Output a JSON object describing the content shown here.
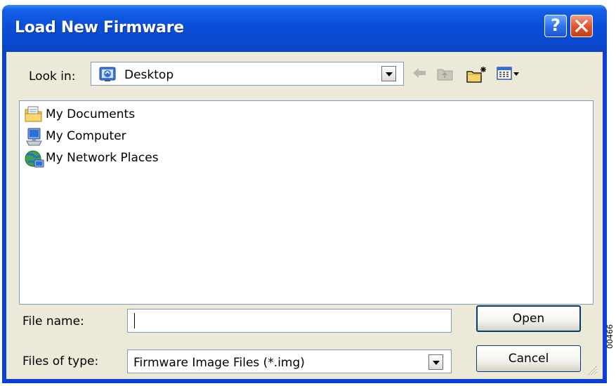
{
  "window": {
    "title": "Load New Firmware",
    "help_label": "?",
    "colors": {
      "titlebar": "#0b4fd9",
      "client": "#ece9d8",
      "close": "#e0562f"
    }
  },
  "toolbar": {
    "lookin_label": "Look in:",
    "lookin_value": "Desktop",
    "icons": [
      "back-icon",
      "up-folder-icon",
      "new-folder-icon",
      "view-menu-icon"
    ]
  },
  "files": [
    {
      "name": "My Documents",
      "icon": "my-documents-icon"
    },
    {
      "name": "My Computer",
      "icon": "my-computer-icon"
    },
    {
      "name": "My Network Places",
      "icon": "my-network-places-icon"
    }
  ],
  "form": {
    "filename_label": "File name:",
    "filename_value": "",
    "filetype_label": "Files of type:",
    "filetype_value": "Firmware Image Files (*.img)"
  },
  "buttons": {
    "open": "Open",
    "cancel": "Cancel"
  },
  "side_text": "00466"
}
